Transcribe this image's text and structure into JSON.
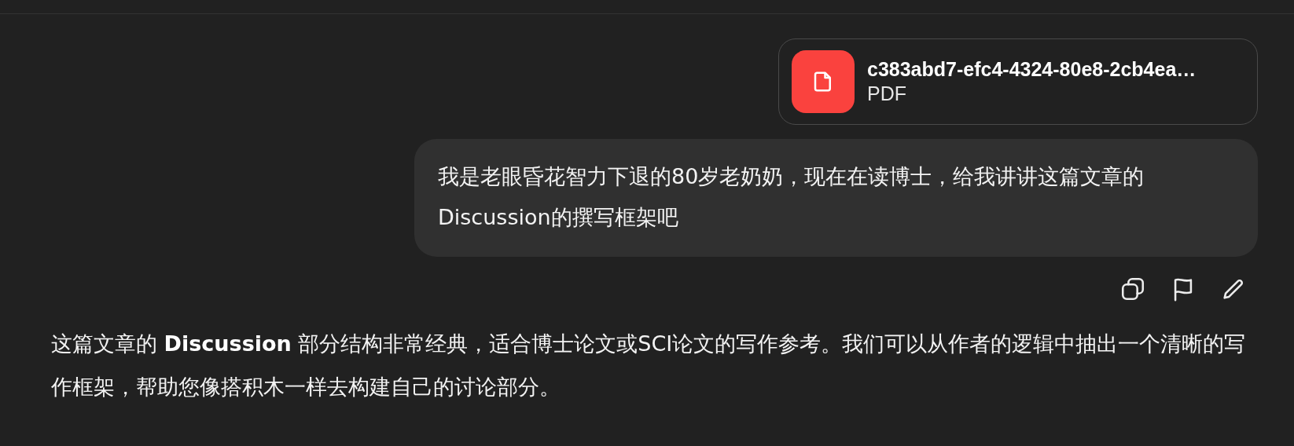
{
  "attachment": {
    "name": "c383abd7-efc4-4324-80e8-2cb4ea…",
    "type": "PDF"
  },
  "user_message": {
    "text": "我是老眼昏花智力下退的80岁老奶奶，现在在读博士，给我讲讲这篇文章的Discussion的撰写框架吧"
  },
  "message_actions": [
    {
      "kind": "copy"
    },
    {
      "kind": "flag"
    },
    {
      "kind": "edit"
    }
  ],
  "assistant_message": {
    "text": "这篇文章的 **Discussion** 部分结构非常经典，适合博士论文或SCI论文的写作参考。我们可以从作者的逻辑中抽出一个清晰的写作框架，帮助您像搭积木一样去构建自己的讨论部分。"
  }
}
